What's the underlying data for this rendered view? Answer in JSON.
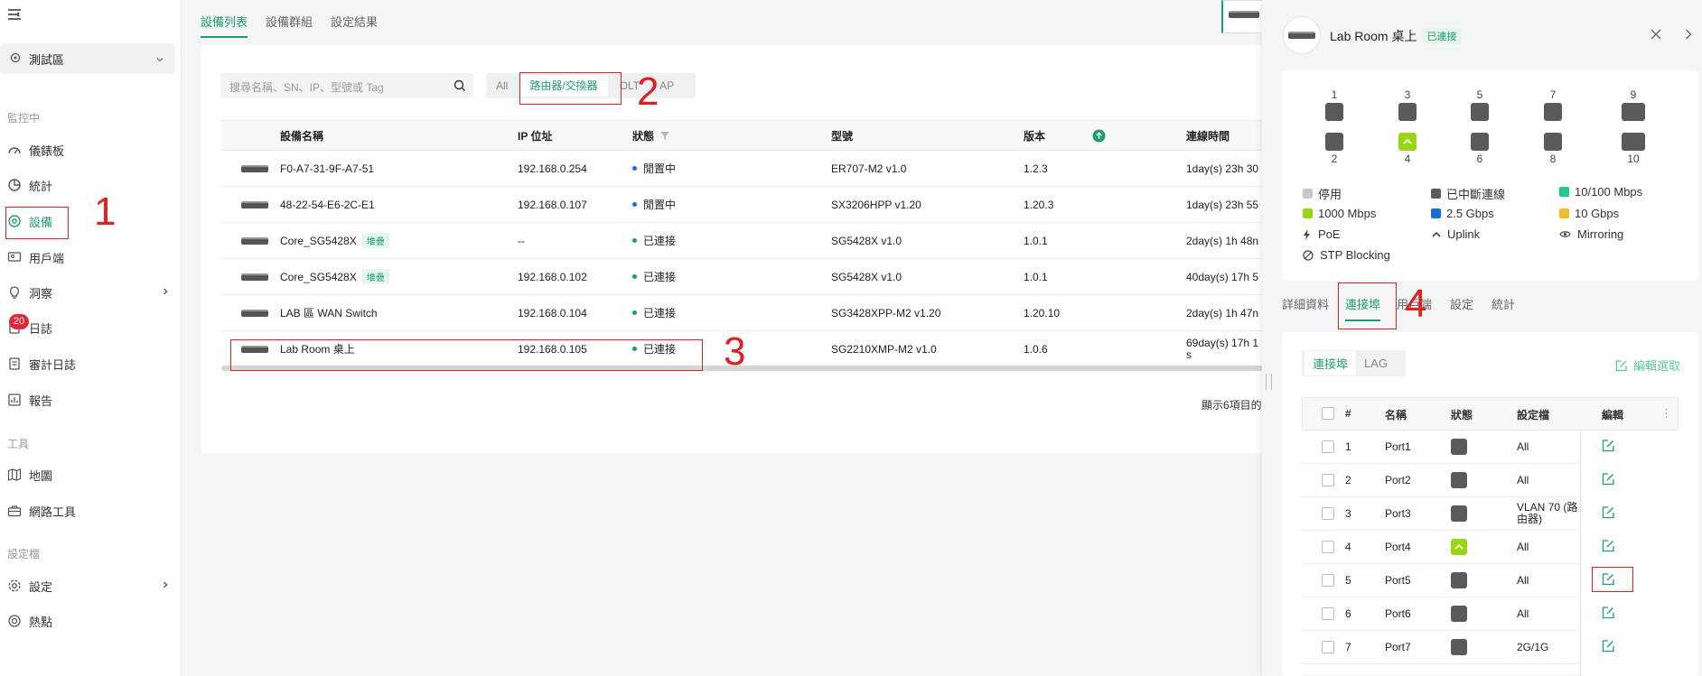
{
  "sidebar": {
    "site": "測試區",
    "sections": [
      {
        "title": "監控中"
      },
      {
        "title": "工具"
      },
      {
        "title": "設定檔"
      }
    ],
    "items": [
      {
        "label": "儀錶板",
        "icon": "dashboard-icon"
      },
      {
        "label": "統計",
        "icon": "pie-chart-icon"
      },
      {
        "label": "設備",
        "icon": "device-icon"
      },
      {
        "label": "用戶端",
        "icon": "client-icon"
      },
      {
        "label": "洞察",
        "icon": "insight-icon"
      },
      {
        "label": "日誌",
        "icon": "log-icon",
        "badge": "20"
      },
      {
        "label": "審計日誌",
        "icon": "audit-log-icon"
      },
      {
        "label": "報告",
        "icon": "report-icon"
      },
      {
        "label": "地圖",
        "icon": "map-icon"
      },
      {
        "label": "網路工具",
        "icon": "toolbox-icon"
      },
      {
        "label": "設定",
        "icon": "gear-icon"
      },
      {
        "label": "熱點",
        "icon": "hotspot-icon"
      }
    ]
  },
  "main": {
    "tabs": [
      "設備列表",
      "設備群組",
      "設定結果"
    ],
    "search_placeholder": "搜尋名稱、SN、IP、型號或 Tag",
    "filters": [
      "All",
      "路由器/交換器",
      "OLT",
      "AP"
    ],
    "columns": [
      "設備名稱",
      "IP 位址",
      "狀態",
      "型號",
      "版本",
      "連線時間"
    ],
    "rows": [
      {
        "name": "F0-A7-31-9F-A7-51",
        "tag": "",
        "ip": "192.168.0.254",
        "status": "閒置中",
        "model": "ER707-M2 v1.0",
        "version": "1.2.3",
        "uptime": "1day(s) 23h 30"
      },
      {
        "name": "48-22-54-E6-2C-E1",
        "tag": "",
        "ip": "192.168.0.107",
        "status": "閒置中",
        "model": "SX3206HPP v1.20",
        "version": "1.20.3",
        "uptime": "1day(s) 23h 55"
      },
      {
        "name": "Core_SG5428X",
        "tag": "堆疊",
        "ip": "--",
        "status": "已連接",
        "model": "SG5428X v1.0",
        "version": "1.0.1",
        "uptime": "2day(s) 1h 48n"
      },
      {
        "name": "Core_SG5428X",
        "tag": "堆疊",
        "ip": "192.168.0.102",
        "status": "已連接",
        "model": "SG5428X v1.0",
        "version": "1.0.1",
        "uptime": "40day(s) 17h 5"
      },
      {
        "name": "LAB 區 WAN Switch",
        "tag": "",
        "ip": "192.168.0.104",
        "status": "已連接",
        "model": "SG3428XPP-M2 v1.20",
        "version": "1.20.10",
        "uptime": "2day(s) 1h 47n"
      },
      {
        "name": "Lab Room 桌上",
        "tag": "",
        "ip": "192.168.0.105",
        "status": "已連接",
        "model": "SG2210XMP-M2 v1.0",
        "version": "1.0.6",
        "uptime": "69day(s) 17h 1",
        "uptime2": "s"
      }
    ],
    "footer": "顯示6項目的"
  },
  "annotations": [
    "1",
    "2",
    "3",
    "4"
  ],
  "panel": {
    "title": "Lab Room 桌上",
    "status": "已連接",
    "ports_top": [
      "1",
      "3",
      "5",
      "7",
      "9"
    ],
    "ports_bottom": [
      "2",
      "4",
      "6",
      "8",
      "10"
    ],
    "legend": [
      "停用",
      "已中斷連線",
      "10/100 Mbps",
      "1000 Mbps",
      "2.5 Gbps",
      "10 Gbps",
      "PoE",
      "Uplink",
      "Mirroring",
      "STP Blocking"
    ],
    "legend_colors": {
      "disabled": "#c8c8c8",
      "disconnected": "#5a5a5a",
      "m100": "#1dc98c",
      "g1": "#99d613",
      "g25": "#1a6fd6",
      "g10": "#f4b92e"
    },
    "tabs": [
      "詳細資料",
      "連接埠",
      "用戶端",
      "設定",
      "統計"
    ],
    "subtabs": [
      "連接埠",
      "LAG"
    ],
    "edit_selected": "編輯選取",
    "port_columns": [
      "#",
      "名稱",
      "狀態",
      "設定檔",
      "編輯"
    ],
    "port_rows": [
      {
        "num": "1",
        "name": "Port1",
        "up": false,
        "profile": "All",
        "profile2": ""
      },
      {
        "num": "2",
        "name": "Port2",
        "up": false,
        "profile": "All",
        "profile2": ""
      },
      {
        "num": "3",
        "name": "Port3",
        "up": false,
        "profile": "VLAN 70 (路",
        "profile2": "由器)"
      },
      {
        "num": "4",
        "name": "Port4",
        "up": true,
        "profile": "All",
        "profile2": ""
      },
      {
        "num": "5",
        "name": "Port5",
        "up": false,
        "profile": "All",
        "profile2": ""
      },
      {
        "num": "6",
        "name": "Port6",
        "up": false,
        "profile": "All",
        "profile2": ""
      },
      {
        "num": "7",
        "name": "Port7",
        "up": false,
        "profile": "2G/1G",
        "profile2": ""
      }
    ]
  }
}
